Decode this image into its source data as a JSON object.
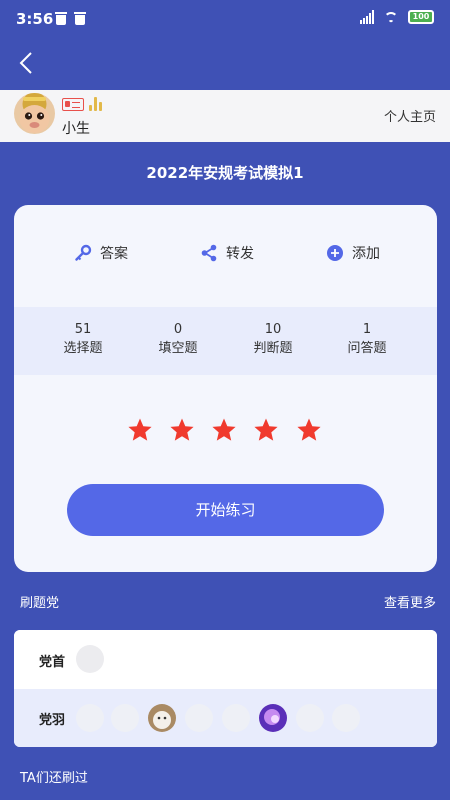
{
  "status_bar": {
    "time": "3:56",
    "battery": "100",
    "icons": [
      "trash-icon",
      "trash-icon",
      "signal-icon",
      "wifi-icon",
      "battery-icon"
    ]
  },
  "nav": {
    "back_icon": "back-arrow-icon"
  },
  "user": {
    "name": "小生",
    "homepage_label": "个人主页",
    "badges": [
      "id-card-icon",
      "rank-bars-icon"
    ]
  },
  "exam": {
    "title": "2022年安规考试模拟1",
    "actions": [
      {
        "label": "答案",
        "icon": "key-icon"
      },
      {
        "label": "转发",
        "icon": "share-icon"
      },
      {
        "label": "添加",
        "icon": "add-circle-icon"
      }
    ],
    "stats": [
      {
        "count": "51",
        "label": "选择题"
      },
      {
        "count": "0",
        "label": "填空题"
      },
      {
        "count": "10",
        "label": "判断题"
      },
      {
        "count": "1",
        "label": "问答题"
      }
    ],
    "rating": {
      "value": 5,
      "max": 5
    },
    "start_label": "开始练习"
  },
  "group": {
    "title": "刷题党",
    "more_label": "查看更多",
    "leader_label": "党首",
    "follower_label": "党羽",
    "follower_count": 8
  },
  "footer": {
    "label": "TA们还刷过"
  },
  "colors": {
    "background": "#3f51b5",
    "card": "#f4f6fd",
    "band": "#e8ecfc",
    "accent": "#5468e7",
    "star": "#f03a2e"
  }
}
